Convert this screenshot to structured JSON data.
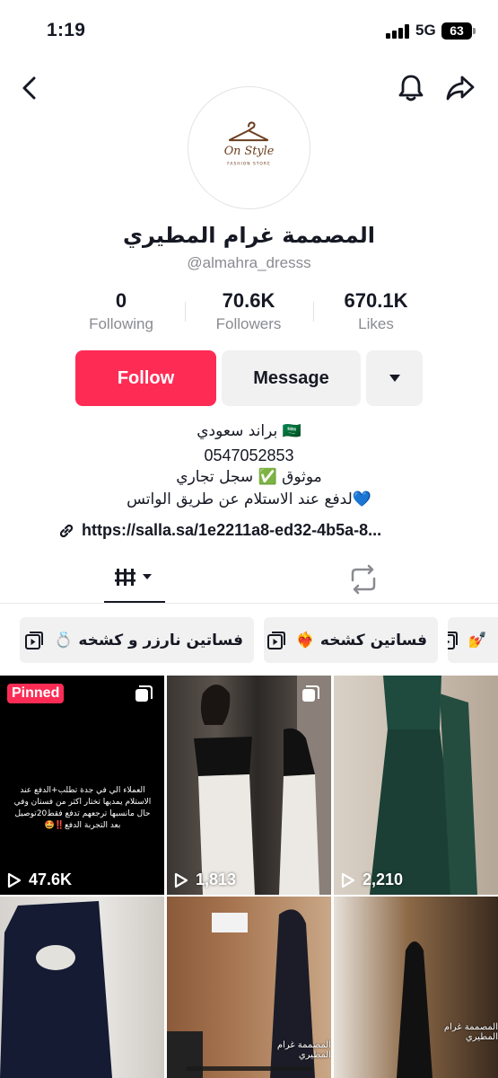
{
  "status": {
    "time": "1:19",
    "network": "5G",
    "battery": "63"
  },
  "profile": {
    "name": "المصممة غرام المطيري",
    "handle": "@almahra_dresss",
    "avatar_text": "On Style",
    "avatar_subtext": "FASHION STORE"
  },
  "stats": [
    {
      "value": "0",
      "label": "Following"
    },
    {
      "value": "70.6K",
      "label": "Followers"
    },
    {
      "value": "670.1K",
      "label": "Likes"
    }
  ],
  "actions": {
    "follow": "Follow",
    "message": "Message"
  },
  "bio": {
    "line1": "براند سعودي 🇸🇦",
    "line2": "0547052853",
    "line3": "موثوق ✅ سجل تجاري",
    "line4": "لدفع عند الاستلام عن طريق الواتس💙",
    "link": "https://salla.sa/1e2211a8-ed32-4b5a-8..."
  },
  "playlists": [
    {
      "label": "فساتين نارزر و كشخه 💍"
    },
    {
      "label": "فساتين كشخه ❤️‍🔥"
    },
    {
      "label": "💅"
    }
  ],
  "videos": [
    {
      "views": "47.6K",
      "pinned_label": "Pinned",
      "overlay_text": "العملاء الي في جدة تطلب+الدفع عند الاستلام يمديها تختار اكثر من فستان وفي حال مانسبها ترجعهم تدفع فقط20توصيل بعد التجربة الدفع‼️🤩"
    },
    {
      "views": "1,813"
    },
    {
      "views": "2,210"
    },
    {
      "views": ""
    },
    {
      "views": "",
      "caption": "المصممة غرام المطيري"
    },
    {
      "views": "",
      "caption": "المصممة غرام المطيري"
    }
  ],
  "colors": {
    "accent": "#fe2c55",
    "button_gray": "#f1f1f2",
    "secondary_text": "#8a8b91"
  }
}
